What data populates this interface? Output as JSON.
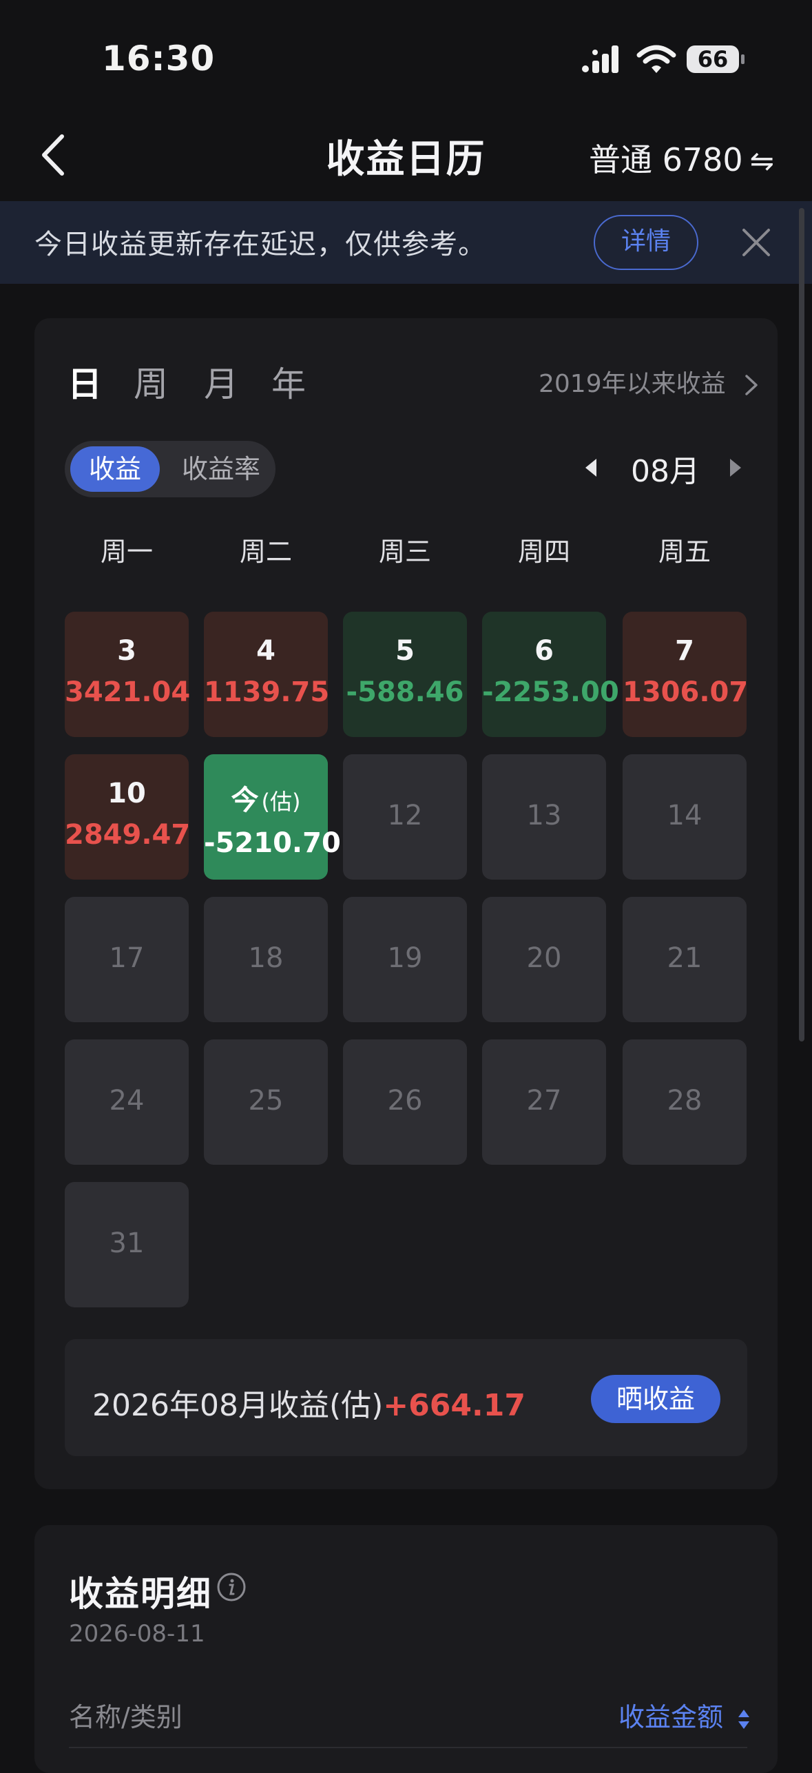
{
  "status_bar": {
    "time": "16:30",
    "battery": "66"
  },
  "nav": {
    "title": "收益日历",
    "account": "普通 6780",
    "swap_symbol": "⇋"
  },
  "banner": {
    "text": "今日收益更新存在延迟，仅供参考。",
    "detail_button": "详情"
  },
  "period_tabs": [
    "日",
    "周",
    "月",
    "年"
  ],
  "since_link": "2019年以来收益",
  "toggle": {
    "selected": "收益",
    "other": "收益率"
  },
  "month": "08月",
  "weekdays": [
    "周一",
    "周二",
    "周三",
    "周四",
    "周五"
  ],
  "days": [
    {
      "day": "3",
      "value": "3421.04",
      "state": "up"
    },
    {
      "day": "4",
      "value": "1139.75",
      "state": "up"
    },
    {
      "day": "5",
      "value": "-588.46",
      "state": "down"
    },
    {
      "day": "6",
      "value": "-2253.00",
      "state": "down"
    },
    {
      "day": "7",
      "value": "1306.07",
      "state": "up"
    },
    {
      "day": "10",
      "value": "2849.47",
      "state": "up"
    },
    {
      "day": "今",
      "estimate_tag": "(估)",
      "value": "-5210.70",
      "state": "today"
    },
    {
      "day": "12",
      "value": "",
      "state": "empty"
    },
    {
      "day": "13",
      "value": "",
      "state": "empty"
    },
    {
      "day": "14",
      "value": "",
      "state": "empty"
    },
    {
      "day": "17",
      "value": "",
      "state": "empty"
    },
    {
      "day": "18",
      "value": "",
      "state": "empty"
    },
    {
      "day": "19",
      "value": "",
      "state": "empty"
    },
    {
      "day": "20",
      "value": "",
      "state": "empty"
    },
    {
      "day": "21",
      "value": "",
      "state": "empty"
    },
    {
      "day": "24",
      "value": "",
      "state": "empty"
    },
    {
      "day": "25",
      "value": "",
      "state": "empty"
    },
    {
      "day": "26",
      "value": "",
      "state": "empty"
    },
    {
      "day": "27",
      "value": "",
      "state": "empty"
    },
    {
      "day": "28",
      "value": "",
      "state": "empty"
    },
    {
      "day": "31",
      "value": "",
      "state": "empty"
    }
  ],
  "summary": {
    "label": "2026年08月收益(估)",
    "value": "+664.17",
    "share_button": "晒收益"
  },
  "details": {
    "title": "收益明细",
    "date": "2026-08-11",
    "col_name": "名称/类别",
    "col_amount": "收益金额"
  },
  "colors": {
    "accent": "#4669d6",
    "up": "#e8524d",
    "down": "#3ea76a",
    "background": "#121214"
  }
}
